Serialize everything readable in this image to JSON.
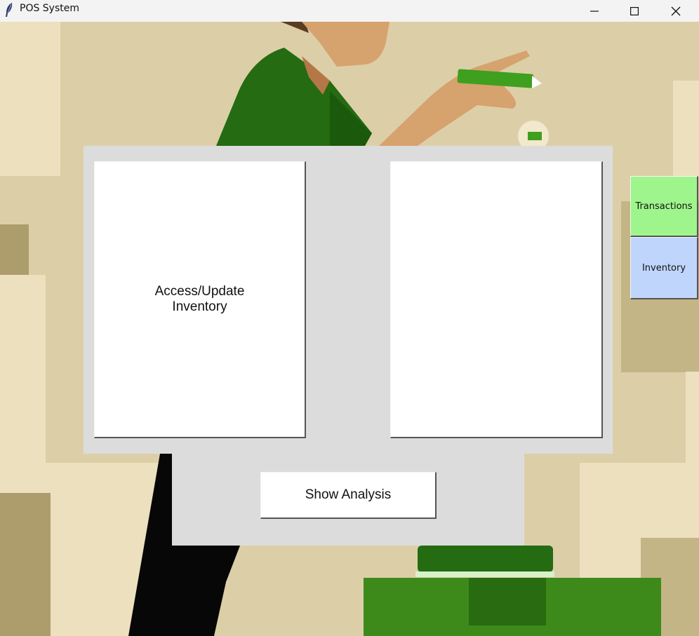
{
  "window": {
    "title": "POS System",
    "controls": [
      "minimize",
      "maximize",
      "close"
    ]
  },
  "main": {
    "left_card_label": "Access/Update Inventory",
    "right_card_label": "",
    "analysis_button": "Show Analysis"
  },
  "sidebar": {
    "transactions_label": "Transactions",
    "inventory_label": "Inventory"
  },
  "colors": {
    "transactions_bg": "#9ef58c",
    "inventory_bg": "#bfd5fb",
    "panel_bg": "#dcdcdc",
    "background": "#dccfa8"
  },
  "icons": {
    "app": "feather-icon",
    "minimize": "minimize-icon",
    "maximize": "maximize-icon",
    "close": "close-icon"
  }
}
